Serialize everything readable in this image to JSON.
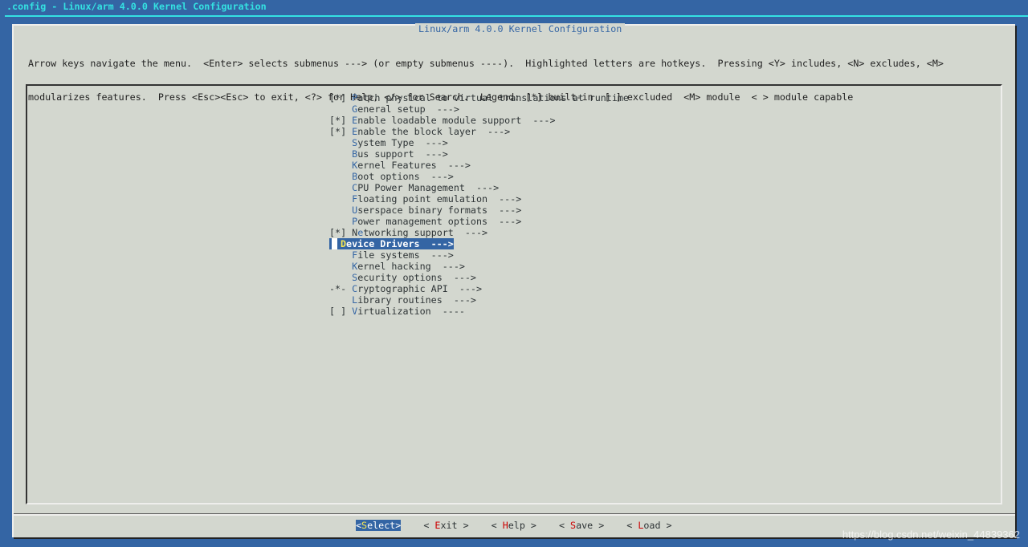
{
  "window_title": ".config - Linux/arm 4.0.0 Kernel Configuration",
  "dialog_title": "Linux/arm 4.0.0 Kernel Configuration",
  "help_lines": [
    "Arrow keys navigate the menu.  <Enter> selects submenus ---> (or empty submenus ----).  Highlighted letters are hotkeys.  Pressing <Y> includes, <N> excludes, <M>",
    "modularizes features.  Press <Esc><Esc> to exit, <?> for Help, </> for Search.  Legend: [*] built-in  [ ] excluded  <M> module  < > module capable"
  ],
  "menu": [
    {
      "prefix": "[*] ",
      "pre": "",
      "hot": "P",
      "post": "atch physical to virtual translations at runtime"
    },
    {
      "prefix": "    ",
      "pre": "",
      "hot": "G",
      "post": "eneral setup  --->"
    },
    {
      "prefix": "[*] ",
      "pre": "",
      "hot": "E",
      "post": "nable loadable module support  --->"
    },
    {
      "prefix": "[*] ",
      "pre": "",
      "hot": "E",
      "post": "nable the block layer  --->"
    },
    {
      "prefix": "    ",
      "pre": "",
      "hot": "S",
      "post": "ystem Type  --->"
    },
    {
      "prefix": "    ",
      "pre": "",
      "hot": "B",
      "post": "us support  --->"
    },
    {
      "prefix": "    ",
      "pre": "",
      "hot": "K",
      "post": "ernel Features  --->"
    },
    {
      "prefix": "    ",
      "pre": "",
      "hot": "B",
      "post": "oot options  --->"
    },
    {
      "prefix": "    ",
      "pre": "",
      "hot": "C",
      "post": "PU Power Management  --->"
    },
    {
      "prefix": "    ",
      "pre": "",
      "hot": "F",
      "post": "loating point emulation  --->"
    },
    {
      "prefix": "    ",
      "pre": "",
      "hot": "U",
      "post": "serspace binary formats  --->"
    },
    {
      "prefix": "    ",
      "pre": "",
      "hot": "P",
      "post": "ower management options  --->"
    },
    {
      "prefix": "[*] ",
      "pre": "N",
      "hot": "e",
      "post": "tworking support  --->"
    },
    {
      "prefix": "    ",
      "pre": "",
      "hot": "D",
      "post": "evice Drivers  --->",
      "selected": true
    },
    {
      "prefix": "    ",
      "pre": "",
      "hot": "F",
      "post": "ile systems  --->"
    },
    {
      "prefix": "    ",
      "pre": "",
      "hot": "K",
      "post": "ernel hacking  --->"
    },
    {
      "prefix": "    ",
      "pre": "",
      "hot": "S",
      "post": "ecurity options  --->"
    },
    {
      "prefix": "-*- ",
      "pre": "",
      "hot": "C",
      "post": "ryptographic API  --->"
    },
    {
      "prefix": "    ",
      "pre": "",
      "hot": "L",
      "post": "ibrary routines  --->"
    },
    {
      "prefix": "[ ] ",
      "pre": "",
      "hot": "V",
      "post": "irtualization  ----"
    }
  ],
  "buttons": [
    {
      "l": "<",
      "k": "S",
      "r": "elect>",
      "selected": true
    },
    {
      "l": "< ",
      "k": "E",
      "r": "xit >"
    },
    {
      "l": "< ",
      "k": "H",
      "r": "elp >"
    },
    {
      "l": "< ",
      "k": "S",
      "r": "ave >"
    },
    {
      "l": "< ",
      "k": "L",
      "r": "oad >"
    }
  ],
  "watermark": "https://blog.csdn.net/weixin_44839362"
}
